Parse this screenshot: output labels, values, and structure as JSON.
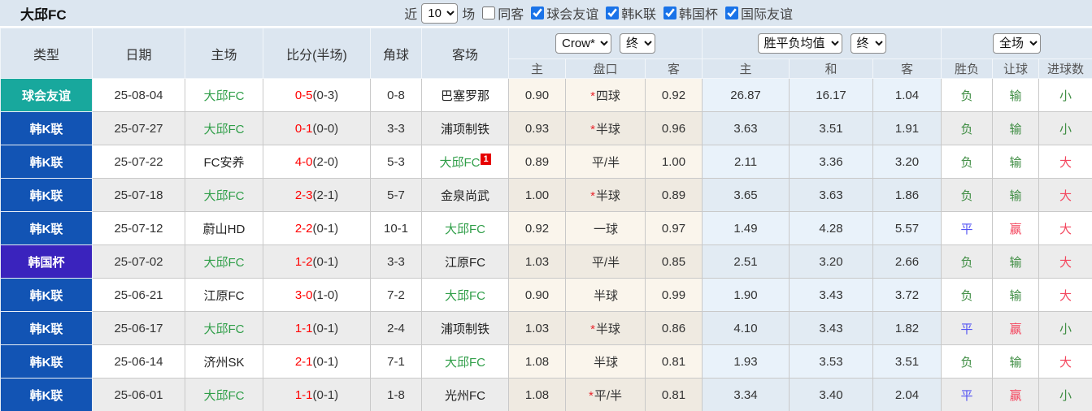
{
  "page": {
    "title": "大邱FC"
  },
  "filters": {
    "recent_label": "近",
    "recent_value": "10",
    "unit_label": "场",
    "same_away_label": "同客",
    "same_away_checked": false,
    "competitions": [
      {
        "label": "球会友谊",
        "checked": true
      },
      {
        "label": "韩K联",
        "checked": true
      },
      {
        "label": "韩国杯",
        "checked": true
      },
      {
        "label": "国际友谊",
        "checked": true
      }
    ]
  },
  "colors": {
    "checkbox_accent": "#1a73e8",
    "type_friendly": "#18a89d",
    "type_kleague": "#1254b4",
    "type_cup": "#3a23bd",
    "self_team_green": "#2f9e48",
    "score_red": "#ff0000",
    "result_green": "#3f8d43",
    "result_blue": "#5353f3",
    "result_red": "#f4465e"
  },
  "table": {
    "header": {
      "columns": [
        "类型",
        "日期",
        "主场",
        "比分(半场)",
        "角球",
        "客场"
      ],
      "company_select": "Crow*",
      "company_period_select": "终",
      "avg_select": "胜平负均值",
      "avg_period_select": "终",
      "scope_select": "全场",
      "sub": [
        "主",
        "盘口",
        "客",
        "主",
        "和",
        "客",
        "胜负",
        "让球",
        "进球数"
      ]
    },
    "rows": [
      {
        "type": "球会友谊",
        "type_key": "friendly",
        "date": "25-08-04",
        "home": "大邱FC",
        "home_self": true,
        "home_card": "",
        "score": "0-5",
        "half": "(0-3)",
        "corners": "0-8",
        "away": "巴塞罗那",
        "away_self": false,
        "away_card": "",
        "odds_home": "0.90",
        "handicap_star": true,
        "handicap": "四球",
        "odds_away": "0.92",
        "avg_home": "26.87",
        "avg_draw": "16.17",
        "avg_away": "1.04",
        "outcome": "负",
        "outcome_color": "green",
        "let": "输",
        "let_color": "green",
        "goals": "小",
        "goals_color": "green"
      },
      {
        "type": "韩K联",
        "type_key": "kleague",
        "date": "25-07-27",
        "home": "大邱FC",
        "home_self": true,
        "home_card": "",
        "score": "0-1",
        "half": "(0-0)",
        "corners": "3-3",
        "away": "浦项制铁",
        "away_self": false,
        "away_card": "",
        "odds_home": "0.93",
        "handicap_star": true,
        "handicap": "半球",
        "odds_away": "0.96",
        "avg_home": "3.63",
        "avg_draw": "3.51",
        "avg_away": "1.91",
        "outcome": "负",
        "outcome_color": "green",
        "let": "输",
        "let_color": "green",
        "goals": "小",
        "goals_color": "green"
      },
      {
        "type": "韩K联",
        "type_key": "kleague",
        "date": "25-07-22",
        "home": "FC安养",
        "home_self": false,
        "home_card": "",
        "score": "4-0",
        "half": "(2-0)",
        "corners": "5-3",
        "away": "大邱FC",
        "away_self": true,
        "away_card": "1",
        "odds_home": "0.89",
        "handicap_star": false,
        "handicap": "平/半",
        "odds_away": "1.00",
        "avg_home": "2.11",
        "avg_draw": "3.36",
        "avg_away": "3.20",
        "outcome": "负",
        "outcome_color": "green",
        "let": "输",
        "let_color": "green",
        "goals": "大",
        "goals_color": "red"
      },
      {
        "type": "韩K联",
        "type_key": "kleague",
        "date": "25-07-18",
        "home": "大邱FC",
        "home_self": true,
        "home_card": "",
        "score": "2-3",
        "half": "(2-1)",
        "corners": "5-7",
        "away": "金泉尚武",
        "away_self": false,
        "away_card": "",
        "odds_home": "1.00",
        "handicap_star": true,
        "handicap": "半球",
        "odds_away": "0.89",
        "avg_home": "3.65",
        "avg_draw": "3.63",
        "avg_away": "1.86",
        "outcome": "负",
        "outcome_color": "green",
        "let": "输",
        "let_color": "green",
        "goals": "大",
        "goals_color": "red"
      },
      {
        "type": "韩K联",
        "type_key": "kleague",
        "date": "25-07-12",
        "home": "蔚山HD",
        "home_self": false,
        "home_card": "",
        "score": "2-2",
        "half": "(0-1)",
        "corners": "10-1",
        "away": "大邱FC",
        "away_self": true,
        "away_card": "",
        "odds_home": "0.92",
        "handicap_star": false,
        "handicap": "一球",
        "odds_away": "0.97",
        "avg_home": "1.49",
        "avg_draw": "4.28",
        "avg_away": "5.57",
        "outcome": "平",
        "outcome_color": "blue",
        "let": "赢",
        "let_color": "red",
        "goals": "大",
        "goals_color": "red"
      },
      {
        "type": "韩国杯",
        "type_key": "cup",
        "date": "25-07-02",
        "home": "大邱FC",
        "home_self": true,
        "home_card": "",
        "score": "1-2",
        "half": "(0-1)",
        "corners": "3-3",
        "away": "江原FC",
        "away_self": false,
        "away_card": "",
        "odds_home": "1.03",
        "handicap_star": false,
        "handicap": "平/半",
        "odds_away": "0.85",
        "avg_home": "2.51",
        "avg_draw": "3.20",
        "avg_away": "2.66",
        "outcome": "负",
        "outcome_color": "green",
        "let": "输",
        "let_color": "green",
        "goals": "大",
        "goals_color": "red"
      },
      {
        "type": "韩K联",
        "type_key": "kleague",
        "date": "25-06-21",
        "home": "江原FC",
        "home_self": false,
        "home_card": "",
        "score": "3-0",
        "half": "(1-0)",
        "corners": "7-2",
        "away": "大邱FC",
        "away_self": true,
        "away_card": "",
        "odds_home": "0.90",
        "handicap_star": false,
        "handicap": "半球",
        "odds_away": "0.99",
        "avg_home": "1.90",
        "avg_draw": "3.43",
        "avg_away": "3.72",
        "outcome": "负",
        "outcome_color": "green",
        "let": "输",
        "let_color": "green",
        "goals": "大",
        "goals_color": "red"
      },
      {
        "type": "韩K联",
        "type_key": "kleague",
        "date": "25-06-17",
        "home": "大邱FC",
        "home_self": true,
        "home_card": "",
        "score": "1-1",
        "half": "(0-1)",
        "corners": "2-4",
        "away": "浦项制铁",
        "away_self": false,
        "away_card": "",
        "odds_home": "1.03",
        "handicap_star": true,
        "handicap": "半球",
        "odds_away": "0.86",
        "avg_home": "4.10",
        "avg_draw": "3.43",
        "avg_away": "1.82",
        "outcome": "平",
        "outcome_color": "blue",
        "let": "赢",
        "let_color": "red",
        "goals": "小",
        "goals_color": "green"
      },
      {
        "type": "韩K联",
        "type_key": "kleague",
        "date": "25-06-14",
        "home": "济州SK",
        "home_self": false,
        "home_card": "",
        "score": "2-1",
        "half": "(0-1)",
        "corners": "7-1",
        "away": "大邱FC",
        "away_self": true,
        "away_card": "",
        "odds_home": "1.08",
        "handicap_star": false,
        "handicap": "半球",
        "odds_away": "0.81",
        "avg_home": "1.93",
        "avg_draw": "3.53",
        "avg_away": "3.51",
        "outcome": "负",
        "outcome_color": "green",
        "let": "输",
        "let_color": "green",
        "goals": "大",
        "goals_color": "red"
      },
      {
        "type": "韩K联",
        "type_key": "kleague",
        "date": "25-06-01",
        "home": "大邱FC",
        "home_self": true,
        "home_card": "",
        "score": "1-1",
        "half": "(0-1)",
        "corners": "1-8",
        "away": "光州FC",
        "away_self": false,
        "away_card": "",
        "odds_home": "1.08",
        "handicap_star": true,
        "handicap": "平/半",
        "odds_away": "0.81",
        "avg_home": "3.34",
        "avg_draw": "3.40",
        "avg_away": "2.04",
        "outcome": "平",
        "outcome_color": "blue",
        "let": "赢",
        "let_color": "red",
        "goals": "小",
        "goals_color": "green"
      }
    ]
  }
}
